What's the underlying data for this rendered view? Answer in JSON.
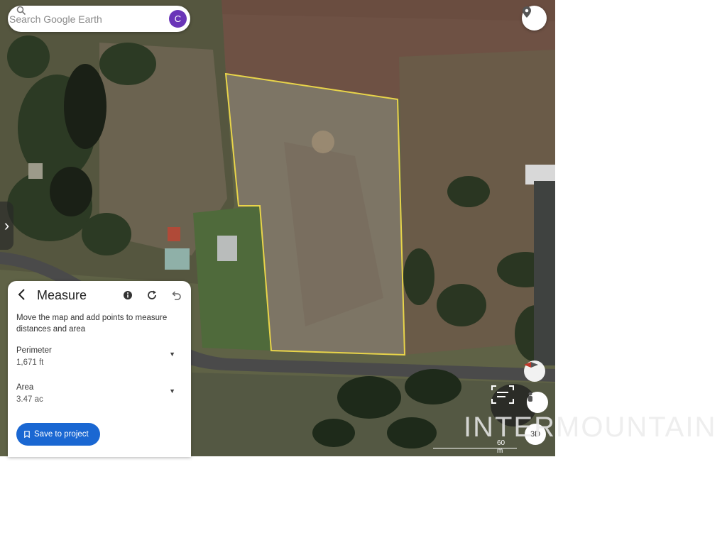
{
  "search": {
    "placeholder": "Search Google Earth",
    "avatar_letter": "C"
  },
  "side_tab": {
    "glyph": "›"
  },
  "measure": {
    "title": "Measure",
    "description": "Move the map and add points to measure distances and area",
    "perimeter_label": "Perimeter",
    "perimeter_value": "1,671 ft",
    "area_label": "Area",
    "area_value": "3.47 ac",
    "save_label": "Save to project"
  },
  "map": {
    "view_3d_label": "3D",
    "scale_label": "60 m",
    "measure_outline_color": "#e8d44a"
  },
  "watermark": "INTERMOUNTAIN",
  "colors": {
    "accent": "#1a67d2",
    "avatar": "#6a35b8"
  }
}
